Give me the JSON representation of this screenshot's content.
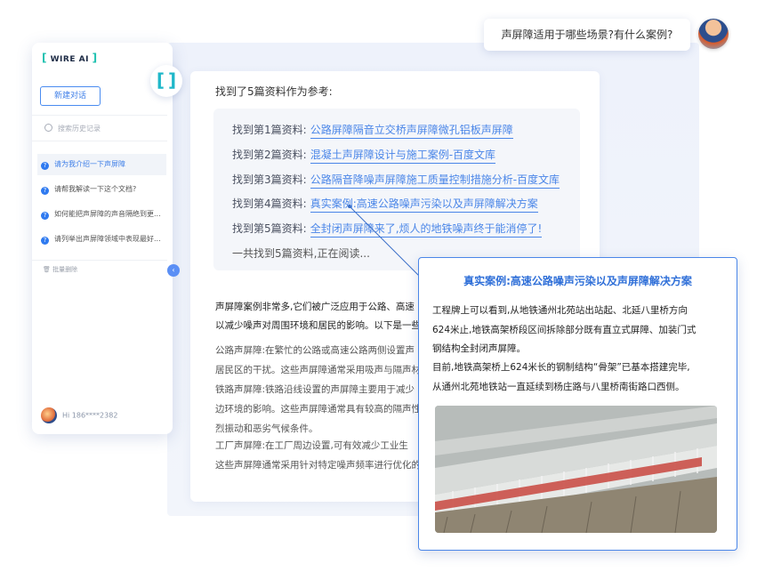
{
  "sidebar": {
    "logo_text": "WIRE AI",
    "new_chat": "新建对话",
    "search_placeholder": "搜索历史记录",
    "history": [
      {
        "label": "请为我介绍一下声屏障"
      },
      {
        "label": "请帮我解读一下这个文档?"
      },
      {
        "label": "如何能把声屏障的声音隔绝到更..."
      },
      {
        "label": "请列举出声屏障领域中表现最好..."
      }
    ],
    "batch_delete": "批量删除",
    "user": "Hi 186****2382"
  },
  "chat": {
    "user_question": "声屏障适用于哪些场景?有什么案例?",
    "found_title": "找到了5篇资料作为参考:",
    "references": [
      {
        "prefix": "找到第1篇资料:",
        "title": "公路屏障隔音立交桥声屏障微孔铝板声屏障"
      },
      {
        "prefix": "找到第2篇资料:",
        "title": "混凝土声屏障设计与施工案例-百度文库"
      },
      {
        "prefix": "找到第3篇资料:",
        "title": "公路隔音降噪声屏障施工质量控制措施分析-百度文库"
      },
      {
        "prefix": "找到第4篇资料:",
        "title": "真实案例:高速公路噪声污染以及声屏障解决方案"
      },
      {
        "prefix": "找到第5篇资料:",
        "title": "全封闭声屏障来了,烦人的地铁噪声终于能消停了!"
      }
    ],
    "total_line": "一共找到5篇资料,正在阅读...",
    "intro_1": "声屏障案例非常多,它们被广泛应用于公路、高速",
    "intro_2": "以减少噪声对周围环境和居民的影响。以下是一些",
    "para_lines": [
      "公路声屏障:在繁忙的公路或高速公路两侧设置声",
      "居民区的干扰。这些声屏障通常采用吸声与隔声材",
      "铁路声屏障:铁路沿线设置的声屏障主要用于减少",
      "边环境的影响。这些声屏障通常具有较高的隔声性",
      "烈振动和恶劣气候条件。",
      "工厂声屏障:在工厂周边设置,可有效减少工业生",
      "这些声屏障通常采用针对特定噪声频率进行优化的"
    ]
  },
  "popup": {
    "title": "真实案例:高速公路噪声污染以及声屏障解决方案",
    "lines": [
      "工程牌上可以看到,从地铁通州北苑站出站起、北延八里桥方向",
      "624米止,地铁高架桥段区间拆除部分既有直立式屏障、加装门式",
      "钢结构全封闭声屏障。",
      "目前,地铁高架桥上624米长的钢制结构“骨架”已基本搭建完毕,",
      "从通州北苑地铁站一直延续到杨庄路与八里桥南街路口西侧。"
    ]
  },
  "colors": {
    "accent": "#4a86e8",
    "brand_teal": "#1fb7c9"
  }
}
